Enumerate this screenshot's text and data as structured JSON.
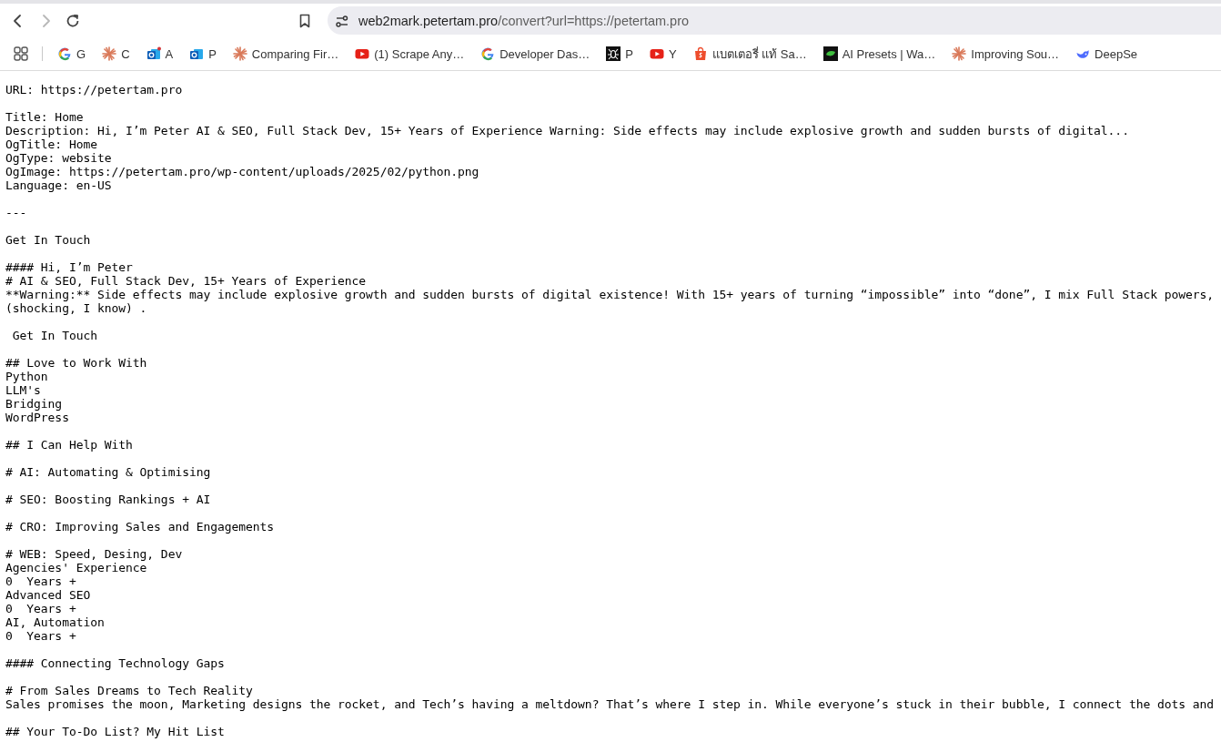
{
  "toolbar": {
    "nav": [
      {
        "kind": "back",
        "disabled": false
      },
      {
        "kind": "forward",
        "disabled": true
      },
      {
        "kind": "reload",
        "disabled": false
      }
    ],
    "address": {
      "host": "web2mark.petertam.pro",
      "path": "/convert?url=https://petertam.pro"
    }
  },
  "bookmarks": [
    {
      "kind": "google",
      "label": "G"
    },
    {
      "kind": "starburst",
      "label": "C"
    },
    {
      "kind": "mail",
      "label": "A"
    },
    {
      "kind": "mail-plain",
      "label": "P"
    },
    {
      "kind": "starburst",
      "label": "Comparing Fir…"
    },
    {
      "kind": "video",
      "label": "(1) Scrape Any…"
    },
    {
      "kind": "google",
      "label": "Developer Das…"
    },
    {
      "kind": "bug",
      "label": "P"
    },
    {
      "kind": "video",
      "label": "Y"
    },
    {
      "kind": "bag",
      "label": "แบตเตอรี่ แท้ Sa…"
    },
    {
      "kind": "leaf",
      "label": "AI Presets | Wa…"
    },
    {
      "kind": "starburst",
      "label": "Improving Sou…"
    },
    {
      "kind": "whale",
      "label": "DeepSe"
    }
  ],
  "document": {
    "blocks": [
      [
        "URL: https://petertam.pro"
      ],
      [
        "Title: Home",
        "Description: Hi, I’m Peter AI & SEO, Full Stack Dev, 15+ Years of Experience Warning: Side effects may include explosive growth and sudden bursts of digital...",
        "OgTitle: Home",
        "OgType: website",
        "OgImage: https://petertam.pro/wp-content/uploads/2025/02/python.png",
        "Language: en-US"
      ],
      [
        "---"
      ],
      [
        "Get In Touch"
      ],
      [
        "#### Hi, I’m Peter",
        "# AI & SEO, Full Stack Dev, 15+ Years of Experience",
        "**Warning:** Side effects may include explosive growth and sudden bursts of digital existence! With 15+ years of turning “impossible” into “done”, I mix Full Stack powers,",
        "(shocking, I know) ."
      ],
      [
        " Get In Touch"
      ],
      [
        "## Love to Work With",
        "Python",
        "LLM's",
        "Bridging",
        "WordPress"
      ],
      [
        "## I Can Help With"
      ],
      [
        "# AI: Automating & Optimising"
      ],
      [
        "# SEO: Boosting Rankings + AI"
      ],
      [
        "# CRO: Improving Sales and Engagements"
      ],
      [
        "# WEB: Speed, Desing, Dev",
        "Agencies' Experience",
        "0  Years +",
        "Advanced SEO",
        "0  Years +",
        "AI, Automation",
        "0  Years +"
      ],
      [
        "#### Connecting Technology Gaps"
      ],
      [
        "# From Sales Dreams to Tech Reality",
        "Sales promises the moon, Marketing designs the rocket, and Tech’s having a meltdown? That’s where I step in. While everyone’s stuck in their bubble, I connect the dots and"
      ],
      [
        "## Your To-Do List? My Hit List"
      ]
    ]
  }
}
